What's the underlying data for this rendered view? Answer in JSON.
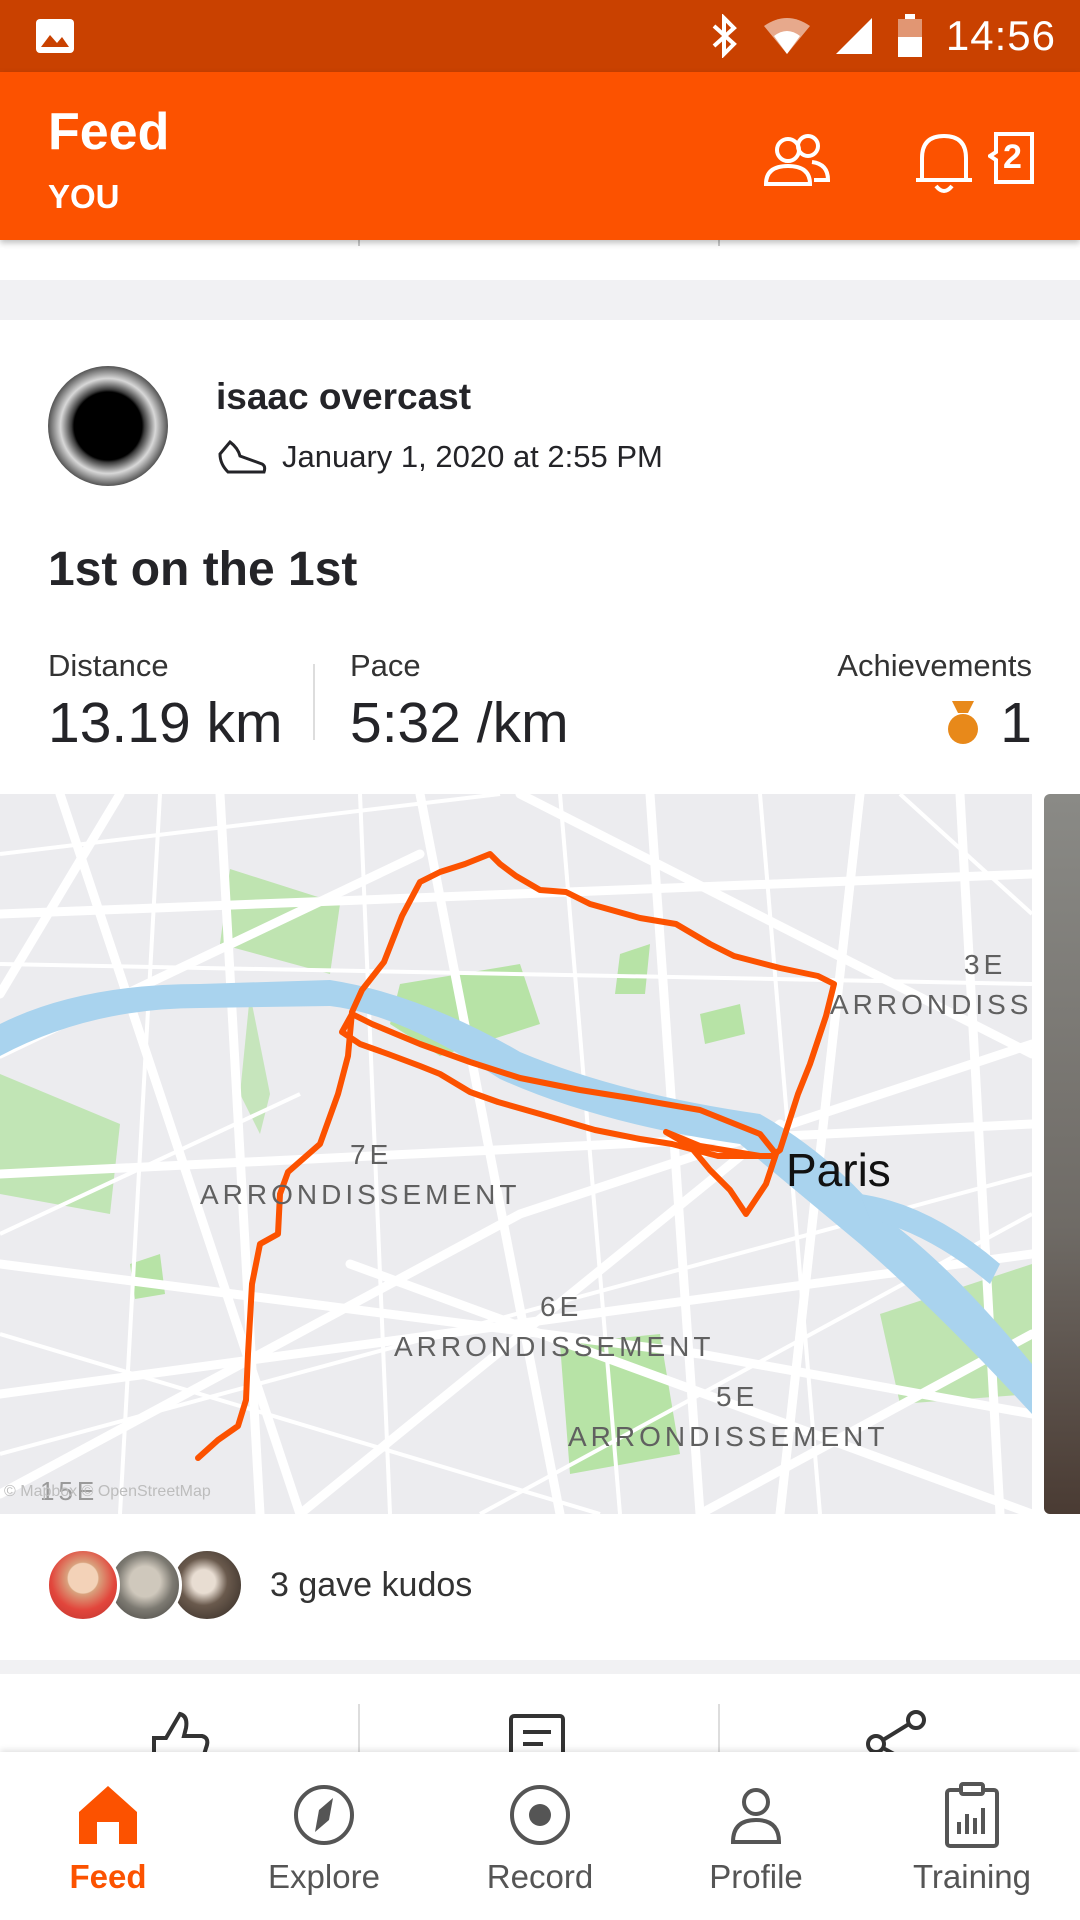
{
  "status_bar": {
    "time": "14:56",
    "icons": [
      "image-icon",
      "bluetooth-icon",
      "wifi-icon",
      "signal-icon",
      "battery-icon"
    ]
  },
  "header": {
    "title": "Feed",
    "subtitle": "YOU",
    "notification_count": "2",
    "icons": [
      "people-icon",
      "bell-icon"
    ]
  },
  "post": {
    "athlete_name": "isaac overcast",
    "date": "January 1, 2020 at 2:55 PM",
    "activity_icon": "shoe-icon",
    "title": "1st on the 1st",
    "stats": {
      "distance_label": "Distance",
      "distance_value": "13.19 km",
      "pace_label": "Pace",
      "pace_value": "5:32 /km",
      "achievements_label": "Achievements",
      "achievements_value": "1"
    },
    "map": {
      "labels": {
        "arr7_num": "7E",
        "arr7_name": "ARRONDISSEMENT",
        "arr6_num": "6E",
        "arr6_name": "ARRONDISSEMENT",
        "arr5_num": "5E",
        "arr5_name": "ARRONDISSEMENT",
        "arr3_num": "3E",
        "arr3_name": "ARRONDISS",
        "city": "Paris",
        "arr15": "15E",
        "attribution": "© Mapbox © OpenStreetMap"
      },
      "route_color": "#fc5200"
    },
    "kudos_text": "3 gave kudos"
  },
  "actions": {
    "icons": [
      "kudos-thumb-icon",
      "comment-icon",
      "share-icon"
    ]
  },
  "bottom_nav": {
    "items": [
      {
        "label": "Feed",
        "icon": "home-icon",
        "active": true
      },
      {
        "label": "Explore",
        "icon": "compass-icon",
        "active": false
      },
      {
        "label": "Record",
        "icon": "record-icon",
        "active": false
      },
      {
        "label": "Profile",
        "icon": "profile-icon",
        "active": false
      },
      {
        "label": "Training",
        "icon": "training-icon",
        "active": false
      }
    ]
  },
  "colors": {
    "brand": "#fc5200",
    "status_bar": "#c94100",
    "medal": "#e8891a",
    "water": "#a9d3ee",
    "park": "#b7e3a6"
  }
}
